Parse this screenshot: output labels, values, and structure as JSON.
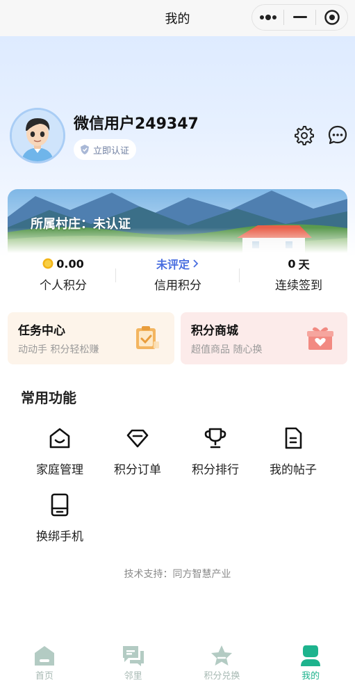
{
  "titlebar": {
    "title": "我的"
  },
  "profile": {
    "username": "微信用户249347",
    "verify_label": "立即认证"
  },
  "banner": {
    "village_text": "所属村庄：未认证"
  },
  "stats": [
    {
      "value": "0.00",
      "label": "个人积分",
      "icon": "coin-icon"
    },
    {
      "value": "未评定",
      "label": "信用积分",
      "icon": "chevron-right-icon"
    },
    {
      "value": "0",
      "unit": "天",
      "label": "连续签到"
    }
  ],
  "cards": {
    "task": {
      "title": "任务中心",
      "subtitle": "动动手 积分轻松赚",
      "icon": "clipboard-check-icon"
    },
    "mall": {
      "title": "积分商城",
      "subtitle": "超值商品 随心换",
      "icon": "gift-box-icon"
    }
  },
  "functions": {
    "title": "常用功能",
    "items": [
      {
        "label": "家庭管理",
        "icon": "home-icon"
      },
      {
        "label": "积分订单",
        "icon": "diamond-icon"
      },
      {
        "label": "积分排行",
        "icon": "trophy-icon"
      },
      {
        "label": "我的帖子",
        "icon": "document-icon"
      },
      {
        "label": "换绑手机",
        "icon": "phone-icon"
      }
    ]
  },
  "support_text": "技术支持：同方智慧产业",
  "tabbar": {
    "items": [
      {
        "label": "首页",
        "icon": "home-tab-icon",
        "active": false
      },
      {
        "label": "邻里",
        "icon": "chat-tab-icon",
        "active": false
      },
      {
        "label": "积分兑换",
        "icon": "star-tab-icon",
        "active": false
      },
      {
        "label": "我的",
        "icon": "user-tab-icon",
        "active": true
      }
    ]
  },
  "colors": {
    "accent": "#1db38d",
    "tab_inactive": "#a7b9b3",
    "credit_blue": "#4a6fe0",
    "task_card_bg": "#fdf4ea",
    "mall_card_bg": "#fcebea"
  }
}
